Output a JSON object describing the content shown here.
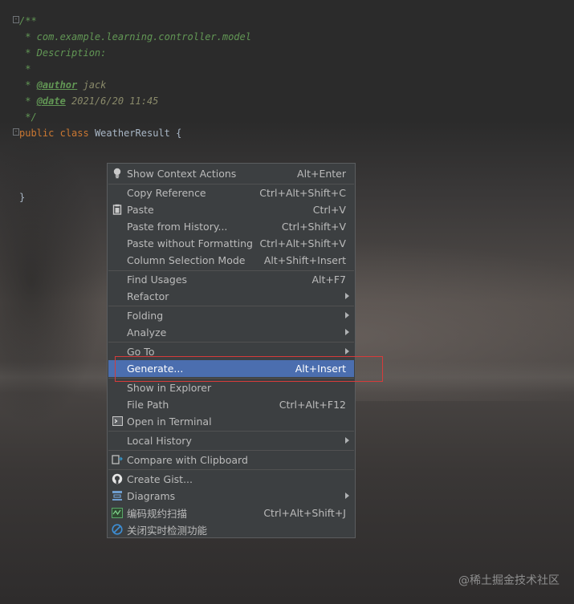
{
  "editor": {
    "fold_symbols": [
      "-",
      "-"
    ],
    "doc_open": "/**",
    "doc_lines": [
      " * com.example.learning.controller.model",
      " * Description:",
      " *"
    ],
    "author": {
      "prefix": " * ",
      "tag": "@author",
      "value": " jack"
    },
    "date": {
      "prefix": " * ",
      "tag": "@date",
      "value": " 2021/6/20 11:45"
    },
    "doc_close": " */",
    "class_line": {
      "kw1": "public",
      "kw2": "class",
      "name": "WeatherResult",
      "brace": "{"
    },
    "close_brace": "}"
  },
  "menu": {
    "items": [
      {
        "label": "Show Context Actions",
        "shortcut": "Alt+Enter",
        "icon": "bulb-icon"
      },
      {
        "label": "Copy Reference",
        "shortcut": "Ctrl+Alt+Shift+C"
      },
      {
        "label": "Paste",
        "shortcut": "Ctrl+V",
        "icon": "clipboard-icon"
      },
      {
        "label": "Paste from History...",
        "shortcut": "Ctrl+Shift+V"
      },
      {
        "label": "Paste without Formatting",
        "shortcut": "Ctrl+Alt+Shift+V"
      },
      {
        "label": "Column Selection Mode",
        "shortcut": "Alt+Shift+Insert"
      },
      {
        "label": "Find Usages",
        "shortcut": "Alt+F7"
      },
      {
        "label": "Refactor",
        "submenu": true
      },
      {
        "label": "Folding",
        "submenu": true
      },
      {
        "label": "Analyze",
        "submenu": true
      },
      {
        "label": "Go To",
        "submenu": true
      },
      {
        "label": "Generate...",
        "shortcut": "Alt+Insert",
        "selected": true
      },
      {
        "label": "Show in Explorer"
      },
      {
        "label": "File Path",
        "shortcut": "Ctrl+Alt+F12"
      },
      {
        "label": "Open in Terminal",
        "icon": "terminal-icon"
      },
      {
        "label": "Local History",
        "submenu": true
      },
      {
        "label": "Compare with Clipboard",
        "icon": "compare-icon"
      },
      {
        "label": "Create Gist...",
        "icon": "github-icon"
      },
      {
        "label": "Diagrams",
        "submenu": true,
        "icon": "diagram-icon"
      },
      {
        "label": "编码规约扫描",
        "shortcut": "Ctrl+Alt+Shift+J",
        "icon": "scan-icon"
      },
      {
        "label": "关闭实时检测功能",
        "icon": "disable-icon"
      }
    ]
  },
  "watermark": "@稀土掘金技术社区",
  "colors": {
    "selection": "#4b6eaf",
    "menu_bg": "#3c3f41",
    "highlight_border": "#d63b3b"
  }
}
